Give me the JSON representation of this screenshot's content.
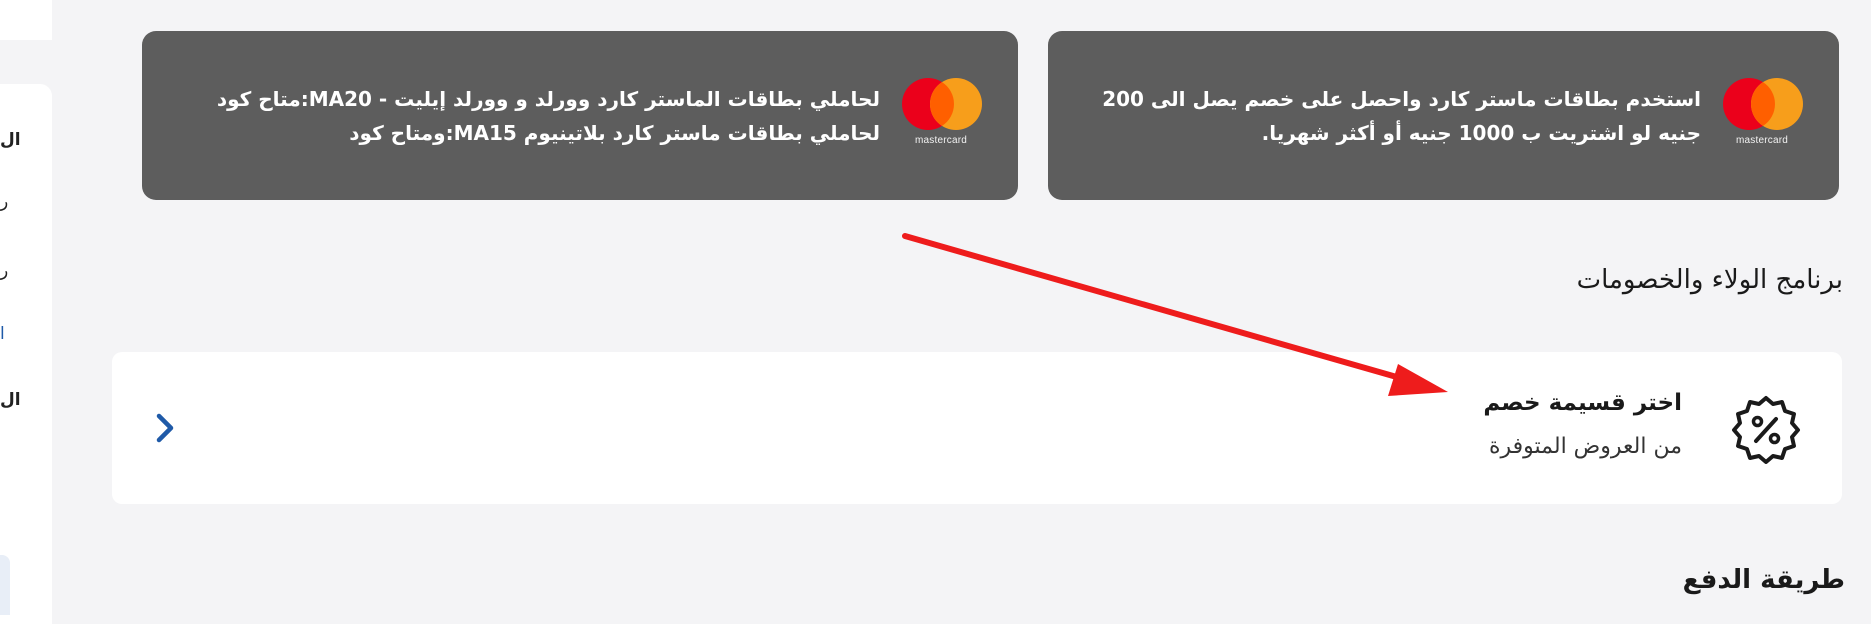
{
  "sidebar": {
    "chars": [
      {
        "text": "ال",
        "style": "bold"
      },
      {
        "text": "ر",
        "style": "normal"
      },
      {
        "text": "ر",
        "style": "normal"
      },
      {
        "text": "ا",
        "style": "blue"
      },
      {
        "text": "ال",
        "style": "bold"
      }
    ]
  },
  "promos": [
    {
      "brand": "mastercard",
      "line1": "استخدم بطاقات ماستر كارد واحصل على خصم يصل الى 200",
      "line2": "جنيه لو اشتريت ب 1000 جنيه أو أكثر شهريا."
    },
    {
      "brand": "mastercard",
      "line1": "لحاملي بطاقات الماستر كارد وورلد و وورلد إيليت - MA20:متاح كود",
      "line2": "لحاملي بطاقات ماستر كارد بلاتينيوم MA15:ومتاح كود"
    }
  ],
  "colors": {
    "card_bg": "#5d5d5d",
    "mc_red": "#eb001b",
    "mc_orange": "#f79e1b",
    "mc_overlap": "#ff5f00",
    "arrow": "#ee1c1c",
    "link_blue": "#1f5aa8"
  },
  "loyalty": {
    "title": "برنامج الولاء والخصومات",
    "option_title": "اختر قسيمة خصم",
    "option_subtitle": "من العروض المتوفرة",
    "icon": "discount-badge-icon",
    "chevron_icon": "chevron-right-icon"
  },
  "payment": {
    "title": "طريقة الدفع"
  }
}
